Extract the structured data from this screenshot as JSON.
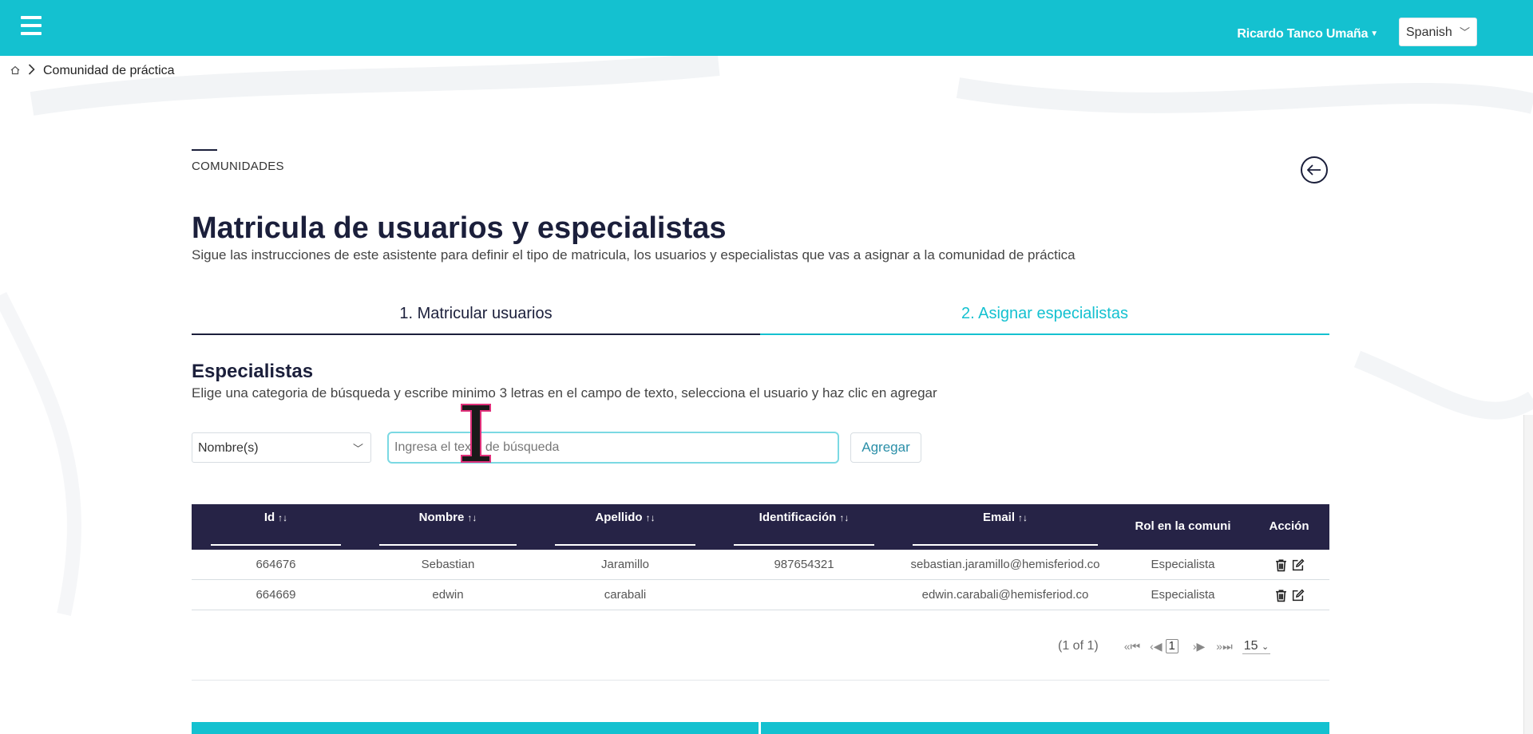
{
  "header": {
    "user_name": "Ricardo Tanco Umaña",
    "language": "Spanish"
  },
  "breadcrumb": {
    "current": "Comunidad de práctica"
  },
  "section_label": "COMUNIDADES",
  "title": "Matricula de usuarios y especialistas",
  "subtitle": "Sigue las instrucciones de este asistente para definir el tipo de matricula, los usuarios y especialistas que vas a asignar a la comunidad de práctica",
  "tabs": [
    {
      "label": "1. Matricular usuarios"
    },
    {
      "label": "2. Asignar especialistas"
    }
  ],
  "specialists": {
    "title": "Especialistas",
    "description": "Elige una categoria de búsqueda y escribe minimo 3 letras en el campo de texto, selecciona el usuario y haz clic en agregar",
    "category": "Nombre(s)",
    "search_placeholder": "Ingresa el texto de búsqueda",
    "add_label": "Agregar"
  },
  "table": {
    "columns": [
      "Id",
      "Nombre",
      "Apellido",
      "Identificación",
      "Email",
      "Rol en la comuni",
      "Acción"
    ],
    "rows": [
      {
        "id": "664676",
        "nombre": "Sebastian",
        "apellido": "Jaramillo",
        "identificacion": "987654321",
        "email": "sebastian.jaramillo@hemisferiod.co",
        "rol": "Especialista"
      },
      {
        "id": "664669",
        "nombre": "edwin",
        "apellido": "carabali",
        "identificacion": "",
        "email": "edwin.carabali@hemisferiod.co",
        "rol": "Especialista"
      }
    ]
  },
  "paginator": {
    "summary": "(1 of 1)",
    "current_page": "1",
    "per_page": "15"
  },
  "colors": {
    "accent": "#14c1d0",
    "header_dark": "#262346",
    "title": "#1b1f3b"
  }
}
